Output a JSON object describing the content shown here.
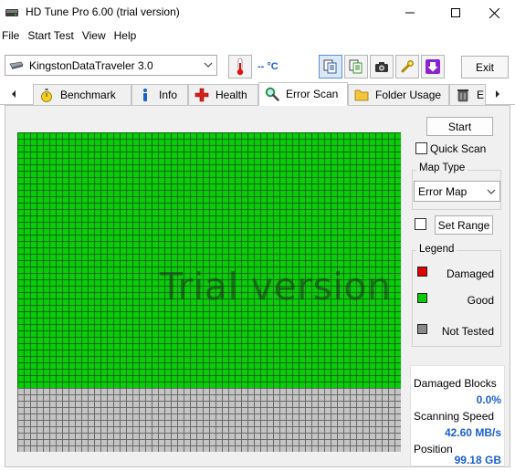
{
  "window": {
    "title": "HD Tune Pro 6.00 (trial version)"
  },
  "menu": [
    "File",
    "Start Test",
    "View",
    "Help"
  ],
  "toolbar": {
    "drive": "KingstonDataTraveler 3.0",
    "temperature": "-- °C",
    "exit_label": "Exit"
  },
  "tabs": [
    {
      "label": "Benchmark",
      "icon": "stopwatch-icon"
    },
    {
      "label": "Info",
      "icon": "info-icon"
    },
    {
      "label": "Health",
      "icon": "health-cross-icon"
    },
    {
      "label": "Error Scan",
      "icon": "magnifier-icon",
      "active": true
    },
    {
      "label": "Folder Usage",
      "icon": "folder-icon"
    },
    {
      "label": "E...",
      "icon": "trash-icon"
    }
  ],
  "error_scan": {
    "start_label": "Start",
    "quick_scan_label": "Quick Scan",
    "quick_scan_checked": false,
    "map_type_label": "Map Type",
    "map_type_value": "Error Map",
    "set_range_label": "Set Range",
    "set_range_checked": false,
    "legend_title": "Legend",
    "legend": [
      {
        "label": "Damaged",
        "color": "#e00000"
      },
      {
        "label": "Good",
        "color": "#0acc0a"
      },
      {
        "label": "Not Tested",
        "color": "#8a8a8a"
      }
    ],
    "map_progress_fraction": 0.8,
    "watermark": "Trial version",
    "stats": {
      "damaged_blocks_label": "Damaged Blocks",
      "damaged_blocks_value": "0.0%",
      "scanning_speed_label": "Scanning Speed",
      "scanning_speed_value": "42.60 MB/s",
      "position_label": "Position",
      "position_value": "99.18 GB"
    }
  }
}
